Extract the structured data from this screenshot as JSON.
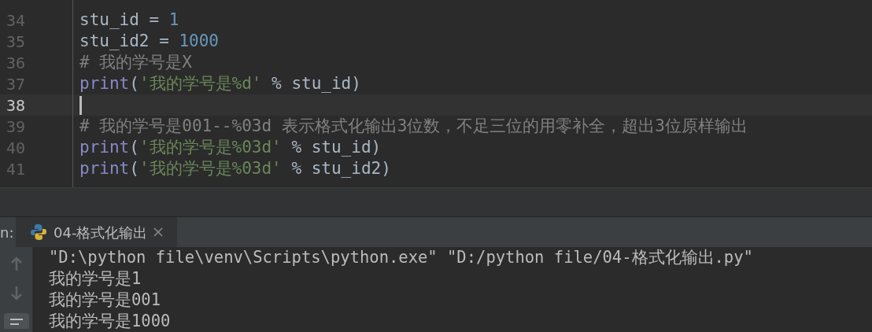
{
  "editor": {
    "lines": [
      {
        "number": "34",
        "current": false,
        "tokens": [
          {
            "kind": "plain",
            "text": "stu_id = "
          },
          {
            "kind": "number",
            "text": "1"
          }
        ]
      },
      {
        "number": "35",
        "current": false,
        "tokens": [
          {
            "kind": "plain",
            "text": "stu_id2 = "
          },
          {
            "kind": "number",
            "text": "1000"
          }
        ]
      },
      {
        "number": "36",
        "current": false,
        "tokens": [
          {
            "kind": "comment",
            "text": "# 我的学号是X"
          }
        ]
      },
      {
        "number": "37",
        "current": false,
        "tokens": [
          {
            "kind": "builtin",
            "text": "print"
          },
          {
            "kind": "plain",
            "text": "("
          },
          {
            "kind": "string",
            "text": "'我的学号是%d'"
          },
          {
            "kind": "plain",
            "text": " % stu_id)"
          }
        ]
      },
      {
        "number": "38",
        "current": true
      },
      {
        "number": "39",
        "current": false,
        "tokens": [
          {
            "kind": "comment",
            "text": "# 我的学号是001--%03d 表示格式化输出3位数，不足三位的用零补全，超出3位原样输出"
          }
        ]
      },
      {
        "number": "40",
        "current": false,
        "tokens": [
          {
            "kind": "builtin",
            "text": "print"
          },
          {
            "kind": "plain",
            "text": "("
          },
          {
            "kind": "string",
            "text": "'我的学号是%03d'"
          },
          {
            "kind": "plain",
            "text": " % stu_id)"
          }
        ]
      },
      {
        "number": "41",
        "current": false,
        "tokens": [
          {
            "kind": "builtin",
            "text": "print"
          },
          {
            "kind": "plain",
            "text": "("
          },
          {
            "kind": "string",
            "text": "'我的学号是%03d'"
          },
          {
            "kind": "plain",
            "text": " % stu_id2)"
          }
        ]
      }
    ]
  },
  "run_panel": {
    "label": "n:",
    "tabs": [
      {
        "title": "04-格式化输出",
        "selected": true
      }
    ],
    "output": [
      "\"D:\\python file\\venv\\Scripts\\python.exe\" \"D:/python file/04-格式化输出.py\"",
      "我的学号是1",
      "我的学号是001",
      "我的学号是1000"
    ]
  }
}
